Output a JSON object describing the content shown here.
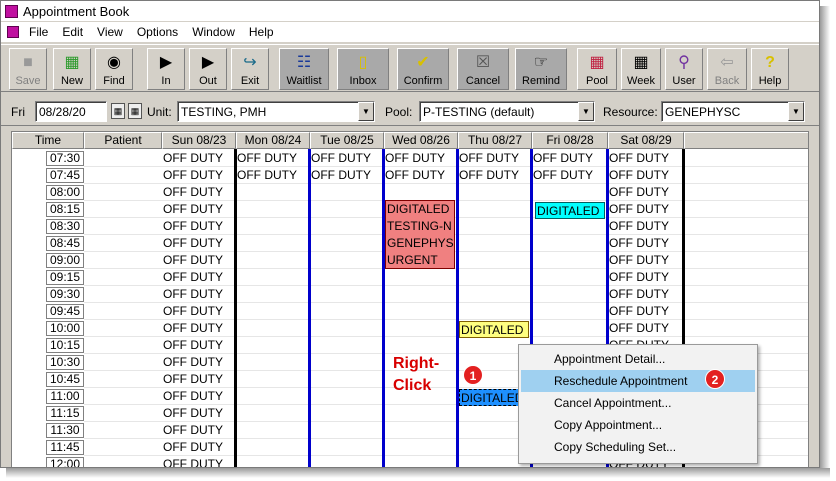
{
  "window": {
    "title": "Appointment Book"
  },
  "menu": [
    "File",
    "Edit",
    "View",
    "Options",
    "Window",
    "Help"
  ],
  "toolbar": [
    {
      "label": "Save",
      "icon": "save-icon",
      "disabled": true
    },
    {
      "label": "New",
      "icon": "new-icon"
    },
    {
      "label": "Find",
      "icon": "binoculars-icon"
    },
    {
      "label": "In",
      "icon": "in-icon"
    },
    {
      "label": "Out",
      "icon": "out-icon"
    },
    {
      "label": "Exit",
      "icon": "exit-icon"
    },
    {
      "label": "Waitlist",
      "icon": "waitlist-icon"
    },
    {
      "label": "Inbox",
      "icon": "inbox-icon"
    },
    {
      "label": "Confirm",
      "icon": "confirm-icon"
    },
    {
      "label": "Cancel",
      "icon": "cancel-icon"
    },
    {
      "label": "Remind",
      "icon": "remind-icon"
    },
    {
      "label": "Pool",
      "icon": "pool-icon"
    },
    {
      "label": "Week",
      "icon": "week-icon"
    },
    {
      "label": "User",
      "icon": "user-icon"
    },
    {
      "label": "Back",
      "icon": "back-icon",
      "disabled": true
    },
    {
      "label": "Help",
      "icon": "help-icon"
    }
  ],
  "filters": {
    "day_label": "Fri",
    "date": "08/28/20",
    "unit_label": "Unit:",
    "unit": "TESTING, PMH",
    "pool_label": "Pool:",
    "pool": "P-TESTING (default)",
    "resource_label": "Resource:",
    "resource": "GENEPHYSC"
  },
  "grid": {
    "headers": [
      "Time",
      "Patient",
      "Sun 08/23",
      "Mon 08/24",
      "Tue 08/25",
      "Wed 08/26",
      "Thu 08/27",
      "Fri 08/28",
      "Sat 08/29"
    ],
    "times": [
      "07:30",
      "07:45",
      "08:00",
      "08:15",
      "08:30",
      "08:45",
      "09:00",
      "09:15",
      "09:30",
      "09:45",
      "10:00",
      "10:15",
      "10:30",
      "10:45",
      "11:00",
      "11:15",
      "11:30",
      "11:45",
      "12:00"
    ],
    "off_duty_text": "OFF DUTY"
  },
  "appointments": [
    {
      "lines": [
        "DIGITALED",
        "TESTING-N",
        "GENEPHYS",
        "URGENT"
      ],
      "color": "#f08080"
    },
    {
      "lines": [
        "DIGITALED"
      ],
      "color": "#00ffff"
    },
    {
      "lines": [
        "DIGITALED"
      ],
      "color": "#ffff80"
    },
    {
      "lines": [
        "DIGITALED"
      ],
      "color": "#1e90ff"
    }
  ],
  "context_menu": [
    {
      "label": "Appointment Detail..."
    },
    {
      "label": "Reschedule Appointment",
      "highlighted": true
    },
    {
      "label": "Cancel Appointment..."
    },
    {
      "label": "Copy Appointment..."
    },
    {
      "label": "Copy Scheduling Set..."
    }
  ],
  "annotations": {
    "right_click": [
      "Right-",
      "Click"
    ],
    "badge1": "1",
    "badge2": "2"
  }
}
